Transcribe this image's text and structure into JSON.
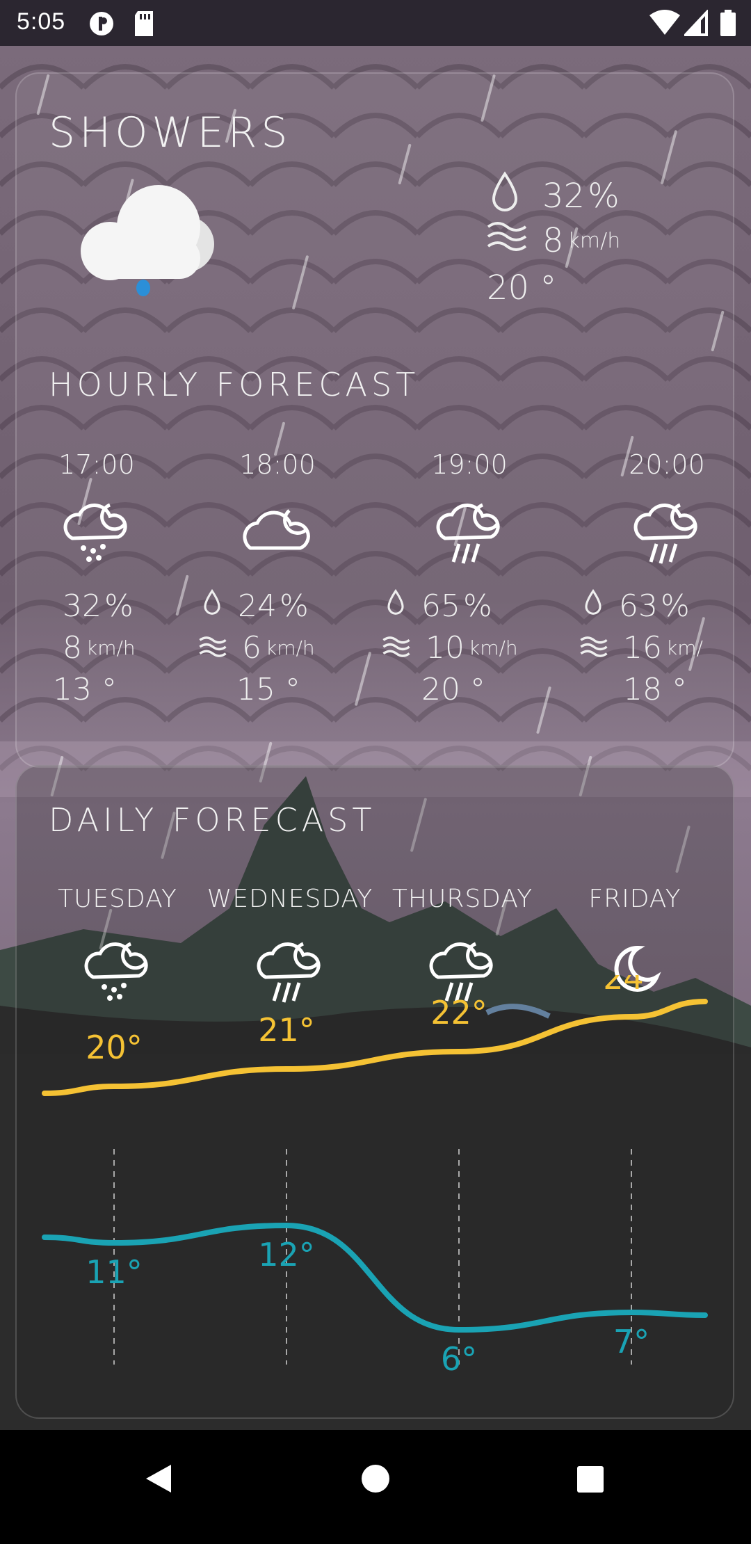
{
  "status_bar": {
    "time": "5:05",
    "icons": [
      "p-badge-icon",
      "sd-card-icon",
      "wifi-icon",
      "signal-icon",
      "battery-icon"
    ]
  },
  "current": {
    "condition": "SHOWERS",
    "icon": "cloud-drizzle-icon",
    "humidity_value": "32",
    "humidity_unit": "%",
    "wind_value": "8",
    "wind_unit": "km/h",
    "temperature": "20 °"
  },
  "hourly": {
    "title": "HOURLY FORECAST",
    "items": [
      {
        "time": "17:00",
        "icon": "night-sleet-icon",
        "humidity": "32",
        "humidity_unit": "%",
        "wind": "8",
        "wind_unit": "km/h",
        "temp": "13 °"
      },
      {
        "time": "18:00",
        "icon": "night-cloudy-icon",
        "humidity": "24",
        "humidity_unit": "%",
        "wind": "6",
        "wind_unit": "km/h",
        "temp": "15 °"
      },
      {
        "time": "19:00",
        "icon": "night-rain-icon",
        "humidity": "65",
        "humidity_unit": "%",
        "wind": "10",
        "wind_unit": "km/h",
        "temp": "20 °"
      },
      {
        "time": "20:00",
        "icon": "night-rain-icon",
        "humidity": "63",
        "humidity_unit": "%",
        "wind": "16",
        "wind_unit": "km/",
        "temp": "18 °"
      }
    ]
  },
  "daily": {
    "title": "DAILY FORECAST",
    "items": [
      {
        "day": "TUESDAY",
        "icon": "night-sleet-icon"
      },
      {
        "day": "WEDNESDAY",
        "icon": "night-rain-icon"
      },
      {
        "day": "THURSDAY",
        "icon": "night-rain-icon"
      },
      {
        "day": "FRIDAY",
        "icon": "moon-icon"
      }
    ]
  },
  "chart_data": {
    "type": "line",
    "categories": [
      "TUESDAY",
      "WEDNESDAY",
      "THURSDAY",
      "FRIDAY"
    ],
    "series": [
      {
        "values": [
          20,
          21,
          22,
          24
        ],
        "labels": [
          "20°",
          "21°",
          "22°",
          "24°"
        ],
        "color": "#f5c234"
      },
      {
        "values": [
          11,
          12,
          6,
          7
        ],
        "labels": [
          "11°",
          "12°",
          "6°",
          "7°"
        ],
        "color": "#1aa3b4"
      }
    ],
    "ylim": [
      4,
      26
    ],
    "grid": "vertical dashed at each day"
  },
  "colors": {
    "high_temp": "#f5c234",
    "low_temp": "#1aa3b4",
    "card_border": "#b8a9b8"
  },
  "nav": {
    "icons": [
      "back-icon",
      "home-icon",
      "recents-icon"
    ]
  }
}
